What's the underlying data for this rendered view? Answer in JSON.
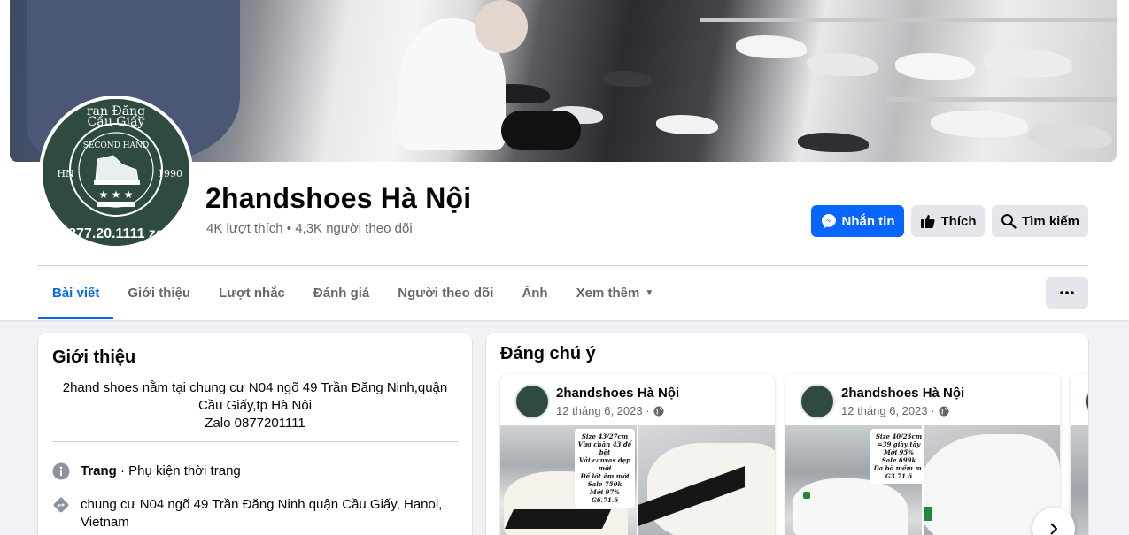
{
  "page": {
    "name": "2handshoes Hà Nội",
    "likes": "4K lượt thích",
    "bullet": " • ",
    "followers": "4,3K người theo dõi"
  },
  "avatar": {
    "arc_top": "ran Đăng",
    "arc_top2": "Cầu Giấy",
    "left_text": "HN",
    "right_text": "1990",
    "ring_text": "SECOND HAND",
    "phone": "877.20.1111 za"
  },
  "actions": {
    "message": "Nhắn tin",
    "like": "Thích",
    "search": "Tìm kiếm"
  },
  "tabs": [
    {
      "label": "Bài viết",
      "active": true
    },
    {
      "label": "Giới thiệu",
      "active": false
    },
    {
      "label": "Lượt nhắc",
      "active": false
    },
    {
      "label": "Đánh giá",
      "active": false
    },
    {
      "label": "Người theo dõi",
      "active": false
    },
    {
      "label": "Ảnh",
      "active": false
    },
    {
      "label": "Xem thêm",
      "active": false
    }
  ],
  "intro": {
    "title": "Giới thiệu",
    "bio_line1": "2hand shoes nằm tại chung cư N04 ngõ 49 Trần Đăng Ninh,quận",
    "bio_line2": "Cầu Giấy,tp Hà Nội",
    "bio_line3": "Zalo 0877201111",
    "category_label": "Trang",
    "category_value": " · Phụ kiện thời trang",
    "address_line1": "chung cư N04 ngõ 49 Trần Đăng Ninh quận Cầu Giấy, Hanoi,",
    "address_line2": "Vietnam"
  },
  "featured": {
    "title": "Đáng chú ý",
    "posts": [
      {
        "author": "2handshoes Hà Nội",
        "date": "12 tháng 6, 2023 ·",
        "tag_lines": [
          "Size 43/27cm",
          "Vừa chân 43 đế bệt",
          "Vải canvas đẹp mới",
          "Đế lót êm mới",
          "Sale 750k",
          "Mới 97%",
          "G6.71.6"
        ]
      },
      {
        "author": "2handshoes Hà Nội",
        "date": "12 tháng 6, 2023 ·",
        "tag_lines": [
          "Size 40/25cm",
          "=39 giày tây",
          "Mới 95%",
          "Sale 699k",
          "Da bò mềm mị",
          "G3.71.6"
        ]
      }
    ]
  },
  "colors": {
    "accent": "#0866ff",
    "text_secondary": "#65676b",
    "button_gray": "#e4e6eb",
    "avatar_green": "#2f4a3e"
  }
}
